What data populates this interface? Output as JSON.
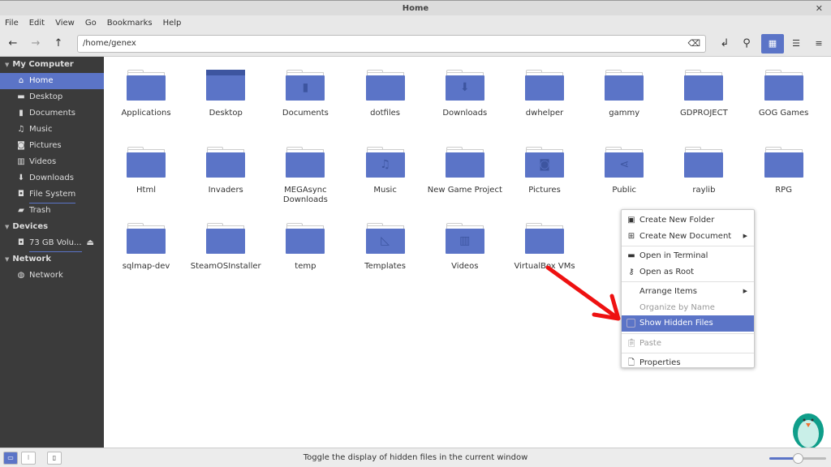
{
  "window": {
    "title": "Home",
    "close": "✕"
  },
  "menu": [
    "File",
    "Edit",
    "View",
    "Go",
    "Bookmarks",
    "Help"
  ],
  "toolbar": {
    "path": "/home/genex"
  },
  "sidebar": {
    "sections": [
      {
        "title": "My Computer",
        "items": [
          {
            "label": "Home",
            "icon": "home-icon",
            "active": true
          },
          {
            "label": "Desktop",
            "icon": "desktop-icon"
          },
          {
            "label": "Documents",
            "icon": "document-icon"
          },
          {
            "label": "Music",
            "icon": "music-icon"
          },
          {
            "label": "Pictures",
            "icon": "camera-icon"
          },
          {
            "label": "Videos",
            "icon": "film-icon"
          },
          {
            "label": "Downloads",
            "icon": "download-icon"
          },
          {
            "label": "File System",
            "icon": "drive-icon"
          },
          {
            "label": "Trash",
            "icon": "trash-icon"
          }
        ]
      },
      {
        "title": "Devices",
        "items": [
          {
            "label": "73 GB Volu...",
            "icon": "drive-icon"
          }
        ]
      },
      {
        "title": "Network",
        "items": [
          {
            "label": "Network",
            "icon": "globe-icon"
          }
        ]
      }
    ]
  },
  "files": [
    {
      "name": "Applications"
    },
    {
      "name": "Desktop",
      "emblem": "desktop"
    },
    {
      "name": "Documents",
      "emblem": "document"
    },
    {
      "name": "dotfiles"
    },
    {
      "name": "Downloads",
      "emblem": "download"
    },
    {
      "name": "dwhelper"
    },
    {
      "name": "gammy"
    },
    {
      "name": "GDPROJECT"
    },
    {
      "name": "GOG Games"
    },
    {
      "name": "Html"
    },
    {
      "name": "Invaders"
    },
    {
      "name": "MEGAsync Downloads"
    },
    {
      "name": "Music",
      "emblem": "music"
    },
    {
      "name": "New Game Project"
    },
    {
      "name": "Pictures",
      "emblem": "camera"
    },
    {
      "name": "Public",
      "emblem": "share"
    },
    {
      "name": "raylib"
    },
    {
      "name": "RPG"
    },
    {
      "name": "sqlmap-dev"
    },
    {
      "name": "SteamOSInstaller"
    },
    {
      "name": "temp"
    },
    {
      "name": "Templates",
      "emblem": "template"
    },
    {
      "name": "Videos",
      "emblem": "film"
    },
    {
      "name": "VirtualBox VMs"
    }
  ],
  "context_menu": {
    "create_folder": "Create New Folder",
    "create_document": "Create New Document",
    "open_terminal": "Open in Terminal",
    "open_root": "Open as Root",
    "arrange": "Arrange Items",
    "organize": "Organize by Name",
    "show_hidden": "Show Hidden Files",
    "show_hidden_checked": false,
    "paste": "Paste",
    "properties": "Properties"
  },
  "status": {
    "text": "Toggle the display of hidden files in the current window",
    "zoom_fraction": 0.5
  },
  "colors": {
    "accent": "#5b74c7",
    "sidebar": "#3b3b3b",
    "arrow": "#ee1111"
  }
}
